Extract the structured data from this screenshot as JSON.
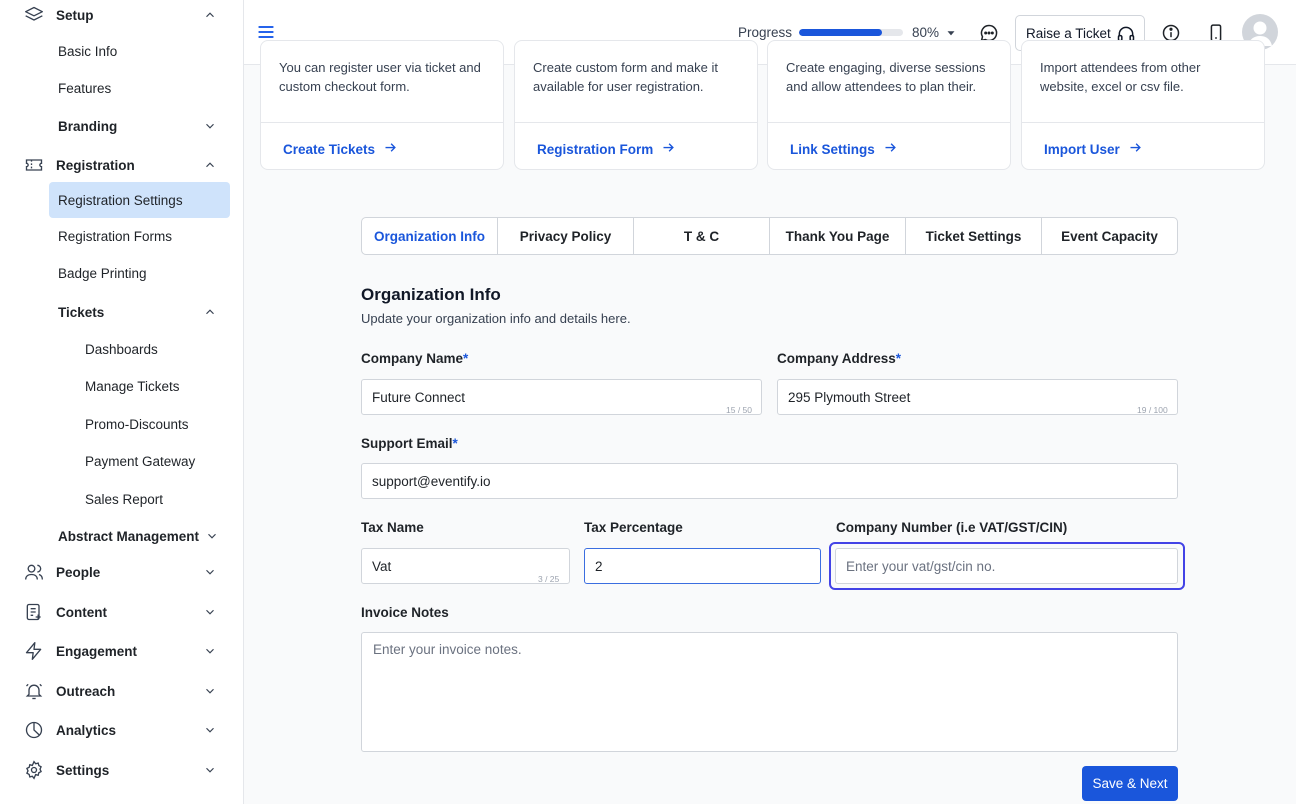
{
  "sidebar": {
    "setup": "Setup",
    "basic_info": "Basic Info",
    "features": "Features",
    "branding": "Branding",
    "registration": "Registration",
    "registration_settings": "Registration Settings",
    "registration_forms": "Registration Forms",
    "badge_printing": "Badge Printing",
    "tickets": "Tickets",
    "dashboards": "Dashboards",
    "manage_tickets": "Manage Tickets",
    "promo_discounts": "Promo-Discounts",
    "payment_gateway": "Payment Gateway",
    "sales_report": "Sales Report",
    "abstract_management": "Abstract Management",
    "people": "People",
    "content": "Content",
    "engagement": "Engagement",
    "outreach": "Outreach",
    "analytics": "Analytics",
    "settings": "Settings"
  },
  "header": {
    "progress_label": "Progress",
    "progress_value": 0.8,
    "progress_pct": "80%",
    "raise_ticket": "Raise a Ticket"
  },
  "cards": [
    {
      "desc": "You can register user via ticket and custom checkout form.",
      "link": "Create Tickets"
    },
    {
      "desc": "Create custom form and make it available for user registration.",
      "link": "Registration Form"
    },
    {
      "desc": "Create engaging, diverse sessions and allow attendees to plan their.",
      "link": "Link Settings"
    },
    {
      "desc": "Import attendees from other website, excel or csv file.",
      "link": "Import User"
    }
  ],
  "tabs": [
    "Organization Info",
    "Privacy Policy",
    "T & C",
    "Thank You Page",
    "Ticket Settings",
    "Event Capacity"
  ],
  "form": {
    "title": "Organization Info",
    "subtitle": "Update your organization info and details here.",
    "company_name_label": "Company Name",
    "company_name_value": "Future Connect",
    "company_name_count": "15 / 50",
    "company_address_label": "Company Address",
    "company_address_value": "295 Plymouth Street",
    "company_address_count": "19 / 100",
    "support_email_label": "Support Email",
    "support_email_value": "support@eventify.io",
    "tax_name_label": "Tax Name",
    "tax_name_value": "Vat",
    "tax_name_count": "3 / 25",
    "tax_percentage_label": "Tax Percentage",
    "tax_percentage_value": "2",
    "company_number_label": "Company Number (i.e VAT/GST/CIN)",
    "company_number_placeholder": "Enter your vat/gst/cin no.",
    "invoice_notes_label": "Invoice Notes",
    "invoice_notes_placeholder": "Enter your invoice notes.",
    "required_mark": "*",
    "save_button": "Save & Next"
  },
  "colors": {
    "accent": "#1a56db",
    "active_nav": "#cfe3fb",
    "focus_ring": "#4343e6"
  }
}
